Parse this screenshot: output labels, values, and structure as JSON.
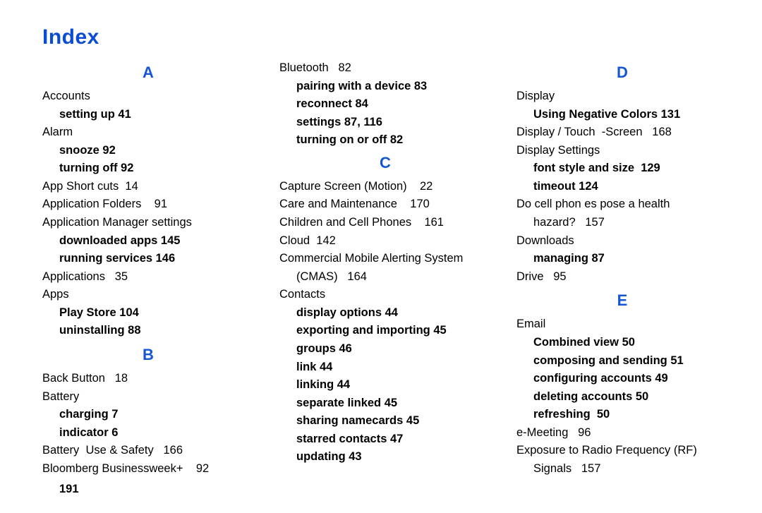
{
  "title": "Index",
  "letters": {
    "A": "A",
    "B": "B",
    "C": "C",
    "D": "D",
    "E": "E"
  },
  "col1": {
    "accounts": "Accounts",
    "accounts_setting_up": "setting up 41",
    "alarm": "Alarm",
    "alarm_snooze": "snooze 92",
    "alarm_turning_off": "turning off 92",
    "app_shortcuts": "App Short cuts  14",
    "application_folders": "Application Folders    91",
    "app_manager_settings": "Application Manager settings",
    "downloaded_apps": "downloaded apps 145",
    "running_services": "running services 146",
    "applications": "Applications   35",
    "apps": "Apps",
    "play_store": "Play Store 104",
    "uninstalling": "uninstalling 88",
    "back_button": "Back Button   18",
    "battery": "Battery",
    "charging": "charging 7",
    "indicator": "indicator 6",
    "battery_use_safety": "Battery  Use & Safety   166",
    "bloomberg": "Bloomberg Businessweek+    92",
    "page_number": "191"
  },
  "col2": {
    "bluetooth": "Bluetooth   82",
    "bt_pairing": "pairing with a device 83",
    "bt_reconnect": "reconnect 84",
    "bt_settings": "settings 87, 116",
    "bt_turning": "turning on or off 82",
    "capture_screen": "Capture Screen (Motion)    22",
    "care_maint": "Care and Maintenance    170",
    "children_cell": "Children and Cell Phones    161",
    "cloud": "Cloud  142",
    "cmas1": "Commercial Mobile Alerting System",
    "cmas2": "(CMAS)   164",
    "contacts": "Contacts",
    "c_display_options": "display options 44",
    "c_export_import": "exporting and importing 45",
    "c_groups": "groups 46",
    "c_link": "link 44",
    "c_linking": "linking 44",
    "c_separate_linked": "separate linked 45",
    "c_sharing_namecards": "sharing namecards 45",
    "c_starred": "starred contacts 47",
    "c_updating": "updating 43"
  },
  "col3": {
    "display": "Display",
    "d_negative_colors": "Using Negative Colors 131",
    "display_touch_screen": "Display / Touch  -Screen   168",
    "display_settings": "Display Settings",
    "d_font_style": "font style and size  129",
    "d_timeout": "timeout 124",
    "hazard1": "Do cell phon es pose a health",
    "hazard2": "hazard?   157",
    "downloads": "Downloads",
    "d_managing": "managing 87",
    "drive": "Drive   95",
    "email": "Email",
    "e_combined_view": "Combined view 50",
    "e_composing_sending": "composing and sending 51",
    "e_config_accounts": "configuring accounts 49",
    "e_deleting_accounts": "deleting accounts 50",
    "e_refreshing": "refreshing  50",
    "e_meeting": "e-Meeting   96",
    "rf1": "Exposure to Radio Frequency (RF)",
    "rf2": "Signals   157"
  }
}
